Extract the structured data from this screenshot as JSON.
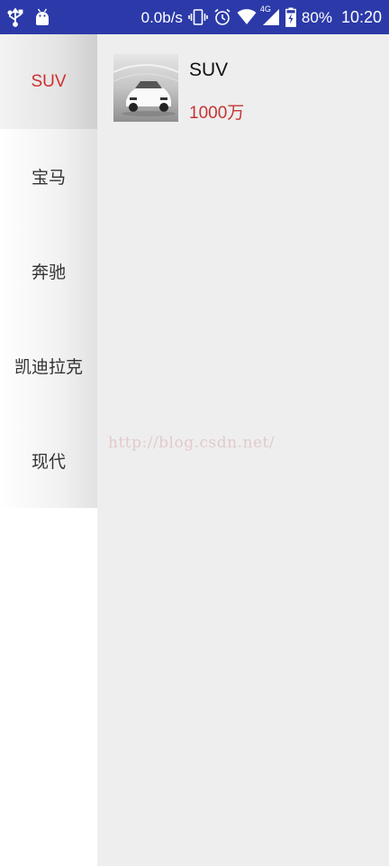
{
  "status_bar": {
    "network_speed": "0.0b/s",
    "network_type": "4G",
    "battery": "80%",
    "time": "10:20",
    "icons": [
      "usb-icon",
      "android-icon",
      "vibrate-icon",
      "alarm-icon",
      "wifi-icon",
      "signal-icon",
      "battery-charging-icon"
    ]
  },
  "sidebar": {
    "items": [
      {
        "label": "SUV",
        "active": true
      },
      {
        "label": "宝马"
      },
      {
        "label": "奔驰"
      },
      {
        "label": "凯迪拉克"
      },
      {
        "label": "现代"
      }
    ]
  },
  "content": {
    "products": [
      {
        "name": "SUV",
        "price": "1000万",
        "image": "white-sports-car"
      }
    ]
  },
  "watermark": "http://blog.csdn.net/",
  "colors": {
    "status_bar": "#2b3aa8",
    "active_text": "#d12f2f",
    "price_text": "#c53434",
    "content_bg": "#eeeeee"
  }
}
